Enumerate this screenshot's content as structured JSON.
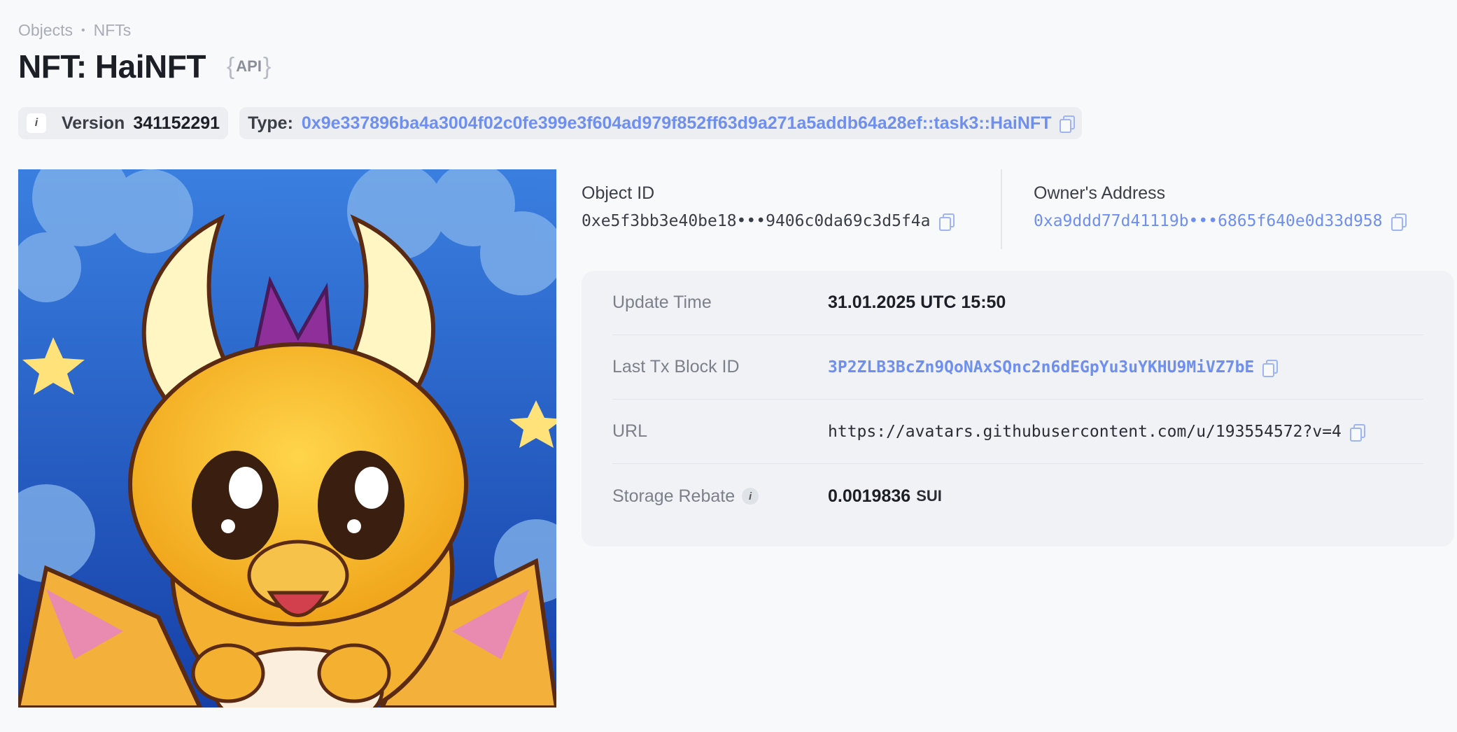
{
  "breadcrumb": {
    "items": [
      "Objects",
      "NFTs"
    ]
  },
  "page": {
    "title": "NFT: HaiNFT",
    "api_tag": "API"
  },
  "version": {
    "label": "Version",
    "value": "341152291"
  },
  "type": {
    "label": "Type:",
    "value": "0x9e337896ba4a3004f02c0fe399e3f604ad979f852ff63d9a271a5addb64a28ef::task3::HaiNFT"
  },
  "object": {
    "label": "Object ID",
    "value": "0xe5f3bb3e40be18•••9406c0da69c3d5f4a"
  },
  "owner": {
    "label": "Owner's Address",
    "value": "0xa9ddd77d41119b•••6865f640e0d33d958"
  },
  "details": {
    "update_time": {
      "label": "Update Time",
      "value": "31.01.2025 UTC 15:50"
    },
    "last_tx": {
      "label": "Last Tx Block ID",
      "value": "3P2ZLB3BcZn9QoNAxSQnc2n6dEGpYu3uYKHU9MiVZ7bE"
    },
    "url": {
      "label": "URL",
      "value": "https://avatars.githubusercontent.com/u/193554572?v=4"
    },
    "storage_rebate": {
      "label": "Storage Rebate",
      "value": "0.0019836",
      "unit": "SUI"
    }
  },
  "colors": {
    "link": "#6e8ff0",
    "background": "#f8f9fb"
  }
}
